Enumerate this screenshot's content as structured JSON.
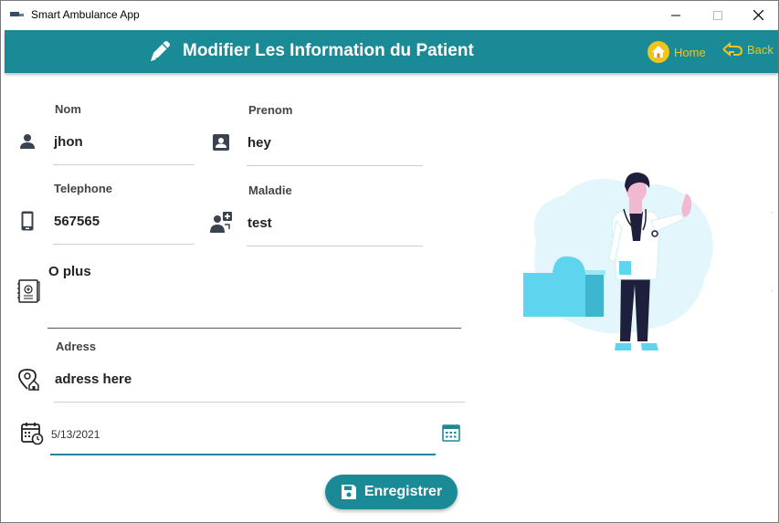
{
  "window": {
    "title": "Smart Ambulance App"
  },
  "header": {
    "title": "Modifier Les Information du Patient",
    "home_label": "Home",
    "back_label": "Back"
  },
  "form": {
    "nom": {
      "label": "Nom",
      "value": "jhon"
    },
    "prenom": {
      "label": "Prenom",
      "value": "hey"
    },
    "telephone": {
      "label": "Telephone",
      "value": "567565"
    },
    "maladie": {
      "label": "Maladie",
      "value": "test"
    },
    "o_plus": {
      "label": "O plus"
    },
    "adress": {
      "label": "Adress",
      "value": "adress here"
    },
    "date": {
      "value": "5/13/2021"
    },
    "save_label": "Enregistrer"
  },
  "colors": {
    "accent": "#1a8a97",
    "nav": "#f0c419"
  }
}
